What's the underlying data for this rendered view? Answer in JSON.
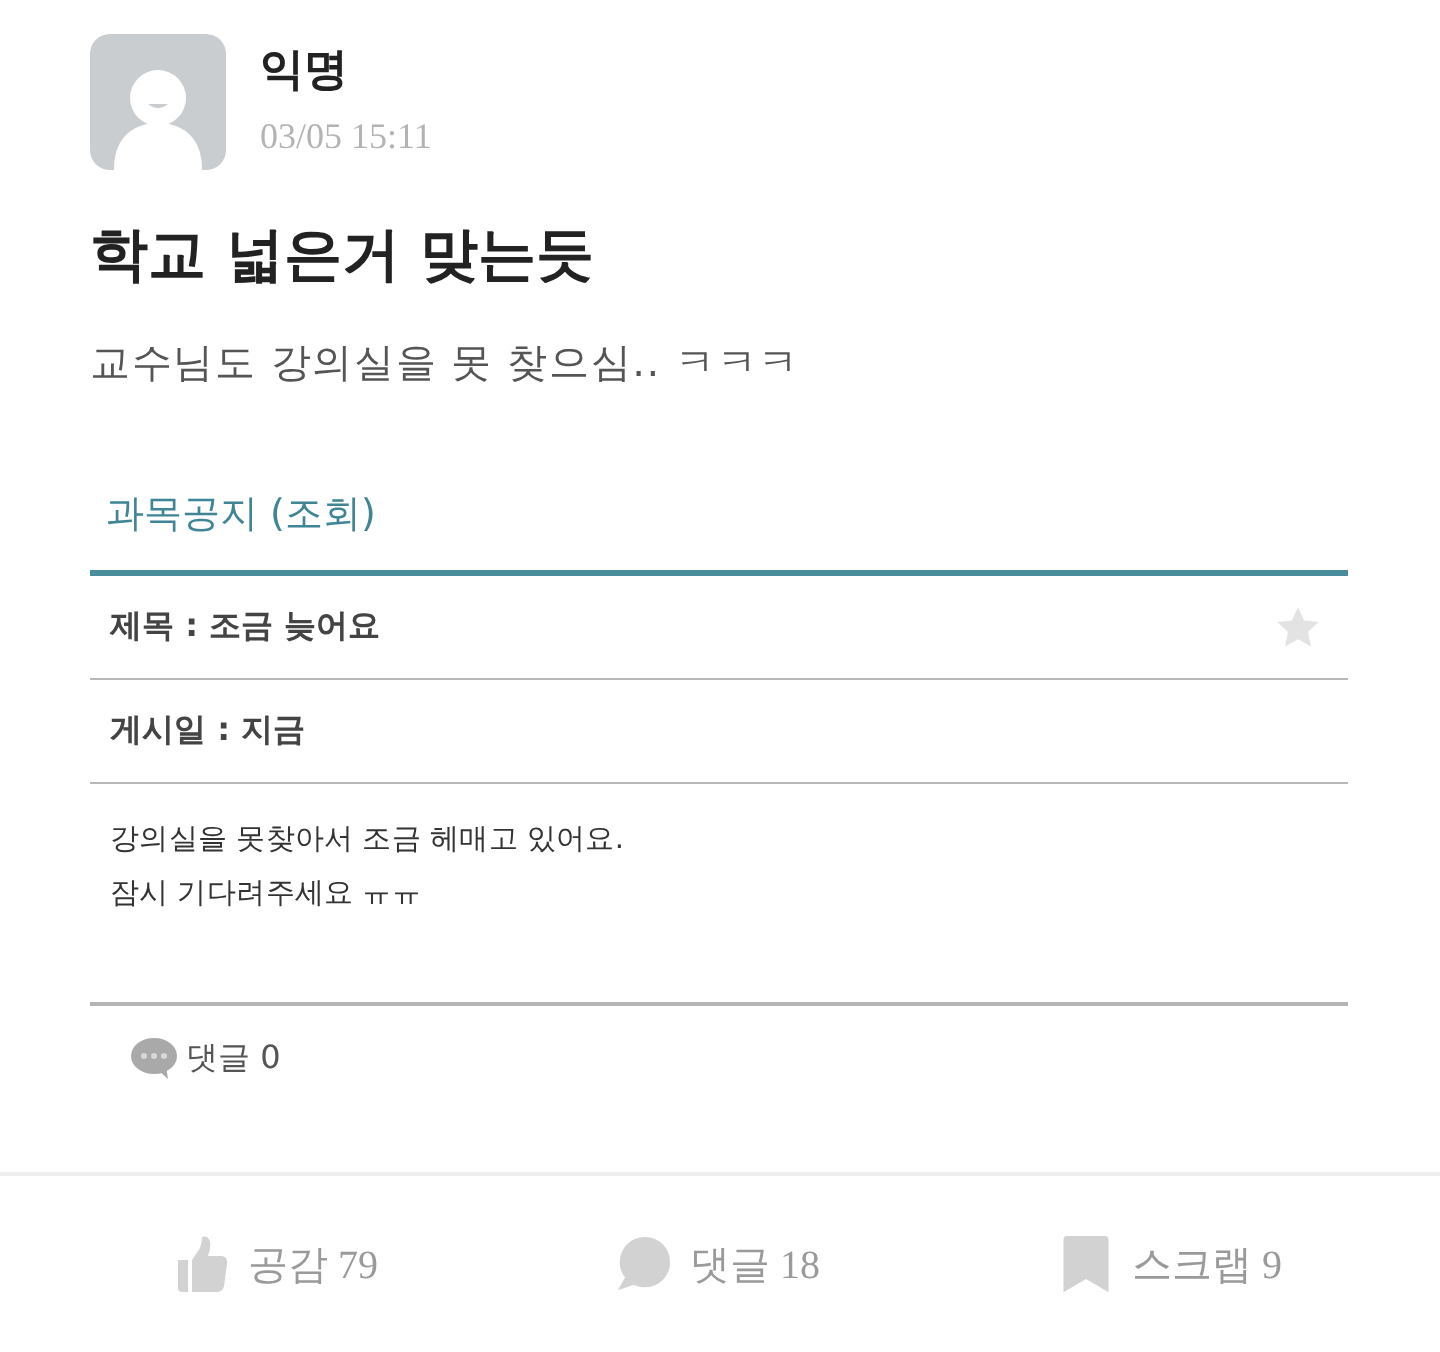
{
  "post": {
    "author": "익명",
    "time": "03/05 15:11",
    "title": "학교 넓은거 맞는듯",
    "body": "교수님도 강의실을 못 찾으심.. ㅋㅋㅋ"
  },
  "notice_card": {
    "header": "과목공지 (조회)",
    "subject": {
      "text": "제목 : 조금 늦어요",
      "starred": false
    },
    "posted": "게시일 : 지금",
    "message": "강의실을 못찾아서 조금 헤매고 있어요.\n잠시 기다려주세요 ㅠㅠ",
    "comments": "댓글 0"
  },
  "actions": [
    {
      "kind": "like",
      "label": "공감 79"
    },
    {
      "kind": "comment",
      "label": "댓글 18"
    },
    {
      "kind": "scrap",
      "label": "스크랩 9"
    }
  ]
}
